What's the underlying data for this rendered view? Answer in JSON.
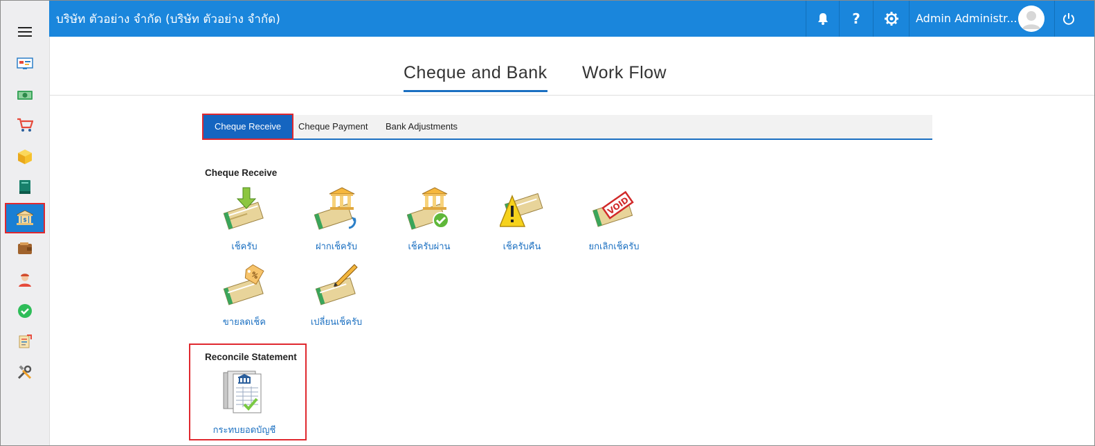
{
  "header": {
    "company": "บริษัท ตัวอย่าง จำกัด (บริษัท ตัวอย่าง จำกัด)",
    "user_name": "Admin Administr...",
    "help_label": "?"
  },
  "main_tabs": [
    {
      "label": "Cheque and Bank",
      "active": true
    },
    {
      "label": "Work Flow",
      "active": false
    }
  ],
  "sub_tabs": [
    {
      "label": "Cheque Receive",
      "active": true
    },
    {
      "label": "Cheque Payment",
      "active": false
    },
    {
      "label": "Bank Adjustments",
      "active": false
    }
  ],
  "sections": {
    "cheque_receive": {
      "title": "Cheque Receive",
      "items": [
        {
          "label": "เช็ครับ",
          "icon": "cheque-receive-icon"
        },
        {
          "label": "ฝากเช็ครับ",
          "icon": "cheque-deposit-icon"
        },
        {
          "label": "เช็ครับผ่าน",
          "icon": "cheque-cleared-icon"
        },
        {
          "label": "เช็ครับคืน",
          "icon": "cheque-returned-icon"
        },
        {
          "label": "ยกเลิกเช็ครับ",
          "icon": "cheque-void-icon"
        },
        {
          "label": "ขายลดเช็ค",
          "icon": "cheque-discount-icon"
        },
        {
          "label": "เปลี่ยนเช็ครับ",
          "icon": "cheque-change-icon"
        }
      ]
    },
    "reconcile": {
      "title": "Reconcile Statement",
      "items": [
        {
          "label": "กระทบยอดบัญชี",
          "icon": "reconcile-statement-icon"
        }
      ]
    }
  },
  "sidebar": {
    "items": [
      "dashboard-icon",
      "money-icon",
      "cart-icon",
      "box-icon",
      "book-icon",
      "bank-icon",
      "wallet-icon",
      "user-icon",
      "check-icon",
      "report-icon",
      "tools-icon"
    ],
    "active_index": 5
  },
  "colors": {
    "header": "#1a86dc",
    "accent": "#1565c0",
    "highlight_border": "#e0282e",
    "link": "#1a6fc1"
  }
}
